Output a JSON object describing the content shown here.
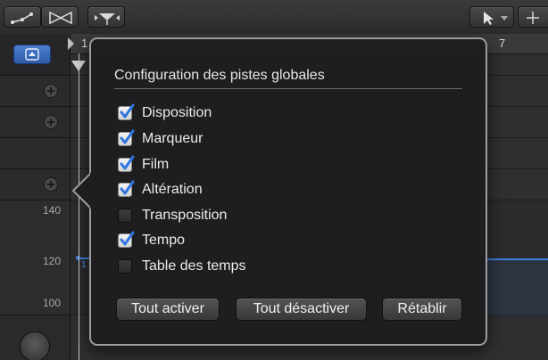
{
  "popover": {
    "title": "Configuration des pistes globales",
    "options": [
      {
        "label": "Disposition",
        "checked": true
      },
      {
        "label": "Marqueur",
        "checked": true
      },
      {
        "label": "Film",
        "checked": true
      },
      {
        "label": "Altération",
        "checked": true
      },
      {
        "label": "Transposition",
        "checked": false
      },
      {
        "label": "Tempo",
        "checked": true
      },
      {
        "label": "Table des temps",
        "checked": false
      }
    ],
    "buttons": {
      "enable_all": "Tout activer",
      "disable_all": "Tout désactiver",
      "reset": "Rétablir"
    }
  },
  "ruler": {
    "bar_start": "1",
    "bar_end": "7"
  },
  "tempo_scale": {
    "high": "140",
    "mid": "120",
    "low": "100",
    "marker": "1"
  },
  "icons": {
    "toolbar": [
      "automation-curve-icon",
      "crossfade-icon",
      "flex-icon",
      "pointer-tool-icon",
      "crosshair-tool-icon"
    ],
    "header": [
      "global-tracks-icon",
      "add-track-icon",
      "knob-icon"
    ]
  },
  "colors": {
    "accent_blue": "#3f7fd8",
    "checkbox_check": "#2f74e0"
  }
}
